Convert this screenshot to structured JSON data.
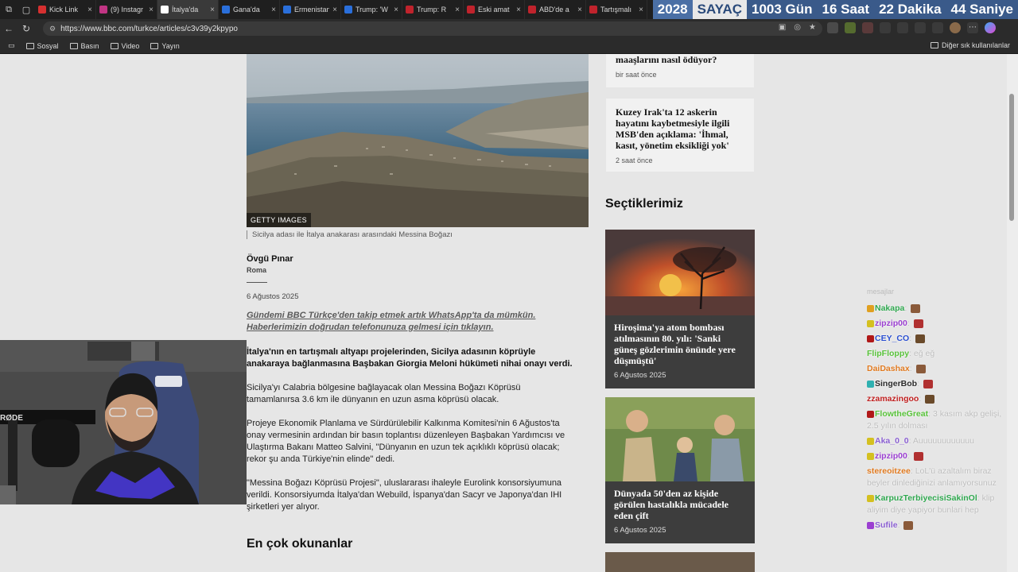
{
  "browser": {
    "tabs": [
      {
        "label": "Kick Link",
        "color": "#d63030"
      },
      {
        "label": "(9) Instagr",
        "color": "#c13584"
      },
      {
        "label": "İtalya'da",
        "color": "#ffffff",
        "active": true
      },
      {
        "label": "Gana'da",
        "color": "#2a6fdb"
      },
      {
        "label": "Ermenistan",
        "color": "#2a6fdb"
      },
      {
        "label": "Trump: 'W",
        "color": "#2a6fdb"
      },
      {
        "label": "Trump: R",
        "color": "#c0232c"
      },
      {
        "label": "Eski amat",
        "color": "#c0232c"
      },
      {
        "label": "ABD'de a",
        "color": "#c0232c"
      },
      {
        "label": "Tartışmalı",
        "color": "#c0232c"
      }
    ],
    "countdown": {
      "year": "2028",
      "label": "SAYAÇ",
      "days": "1003 Gün",
      "hours": "16 Saat",
      "minutes": "22 Dakika",
      "seconds": "44 Saniye"
    },
    "url": "https://www.bbc.com/turkce/articles/c3v39y2kpypo",
    "bookmarks": [
      "Sosyal",
      "Basın",
      "Video",
      "Yayın"
    ],
    "bookmarks_other": "Diğer sık kullanılanlar"
  },
  "article": {
    "image_credit": "GETTY IMAGES",
    "image_caption": "Sicilya adası ile İtalya anakarası arasındaki Messina Boğazı",
    "author": "Övgü Pınar",
    "location": "Roma",
    "date": "6 Ağustos 2025",
    "promo": "Gündemi BBC Türkçe'den takip etmek artık WhatsApp'ta da mümkün. Haberlerimizin doğrudan telefonunuza gelmesi için tıklayın.",
    "lead": "İtalya'nın en tartışmalı altyapı projelerinden, Sicilya adasının köprüyle anakaraya bağlanmasına Başbakan Giorgia Meloni hükümeti nihai onayı verdi.",
    "p1": "Sicilya'yı Calabria bölgesine bağlayacak olan Messina Boğazı Köprüsü tamamlanırsa 3.6 km ile dünyanın en uzun asma köprüsü olacak.",
    "p2": "Projeye Ekonomik Planlama ve Sürdürülebilir Kalkınma Komitesi'nin 6 Ağustos'ta onay vermesinin ardından bir basın toplantısı düzenleyen Başbakan Yardımcısı ve Ulaştırma Bakanı Matteo Salvini, \"Dünyanın en uzun tek açıklıklı köprüsü olacak; rekor şu anda Türkiye'nin elinde\" dedi.",
    "p3": "\"Messina Boğazı Köprüsü Projesi\", uluslararası ihaleyle Eurolink konsorsiyumuna verildi. Konsorsiyumda İtalya'dan Webuild, İspanya'dan Sacyr ve Japonya'dan IHI şirketleri yer alıyor.",
    "most_read": "En çok okunanlar"
  },
  "sidebar": {
    "cards": [
      {
        "title": "maaşlarını nasıl ödüyor?",
        "time": "bir saat önce"
      },
      {
        "title": "Kuzey Irak'ta 12 askerin hayatını kaybetmesiyle ilgili MSB'den açıklama: 'İhmal, kasıt, yönetim eksikliği yok'",
        "time": "2 saat önce"
      }
    ],
    "picks_heading": "Seçtiklerimiz",
    "picks": [
      {
        "title": "Hiroşima'ya atom bombası atılmasının 80. yılı: 'Sanki güneş gözlerimin önünde yere düşmüştü'",
        "date": "6 Ağustos 2025"
      },
      {
        "title": "Dünyada 50'den az kişide görülen hastalıkla mücadele eden çift",
        "date": "6 Ağustos 2025"
      }
    ]
  },
  "chat": {
    "header": "mesajlar",
    "messages": [
      {
        "user": "Nakapa",
        "color": "#2fa84f",
        "text": "",
        "badge": "#e0a020"
      },
      {
        "user": "zipzip00",
        "color": "#9b3fd1",
        "text": "",
        "badge": "#d4c020"
      },
      {
        "user": "CEY_CO",
        "color": "#2a4fd1",
        "text": "",
        "badge": "#b01818"
      },
      {
        "user": "FlipFloppy",
        "color": "#58c23a",
        "text": "eğ eğ",
        "badge": ""
      },
      {
        "user": "DaiDashax",
        "color": "#e07a20",
        "text": "",
        "badge": ""
      },
      {
        "user": "SingerBob",
        "color": "#2a2a2a",
        "text": "",
        "badge": "#2fb0b0"
      },
      {
        "user": "zzamazingoo",
        "color": "#c01f1f",
        "text": "",
        "badge": ""
      },
      {
        "user": "FlowtheGreat",
        "color": "#58c23a",
        "text": "3 kasım akp gelişi, 2.5 yılın dolması",
        "badge": "#b01818"
      },
      {
        "user": "Aka_0_0",
        "color": "#8a5fd1",
        "text": "Auuuuuuuuuuuu",
        "badge": "#d4c020"
      },
      {
        "user": "zipzip00",
        "color": "#9b3fd1",
        "text": "",
        "badge": "#d4c020"
      },
      {
        "user": "stereoitzee",
        "color": "#e07a20",
        "text": "LoL'ü azaltalım biraz beyler dinlediğinizi anlamıyorsunuz",
        "badge": ""
      },
      {
        "user": "KarpuzTerbiyecisiSakinOl",
        "color": "#2fa84f",
        "text": "klip aliyim diye yapiyor bunlari hep",
        "badge": "#d4c020"
      },
      {
        "user": "Sufile",
        "color": "#8a5fd1",
        "text": "",
        "badge": "#9b3fd1"
      }
    ]
  },
  "colors": {
    "page_bg": "#e6e6e6",
    "countdown_blue": "#3a5a8a",
    "card_bg": "#f1f1f1"
  }
}
